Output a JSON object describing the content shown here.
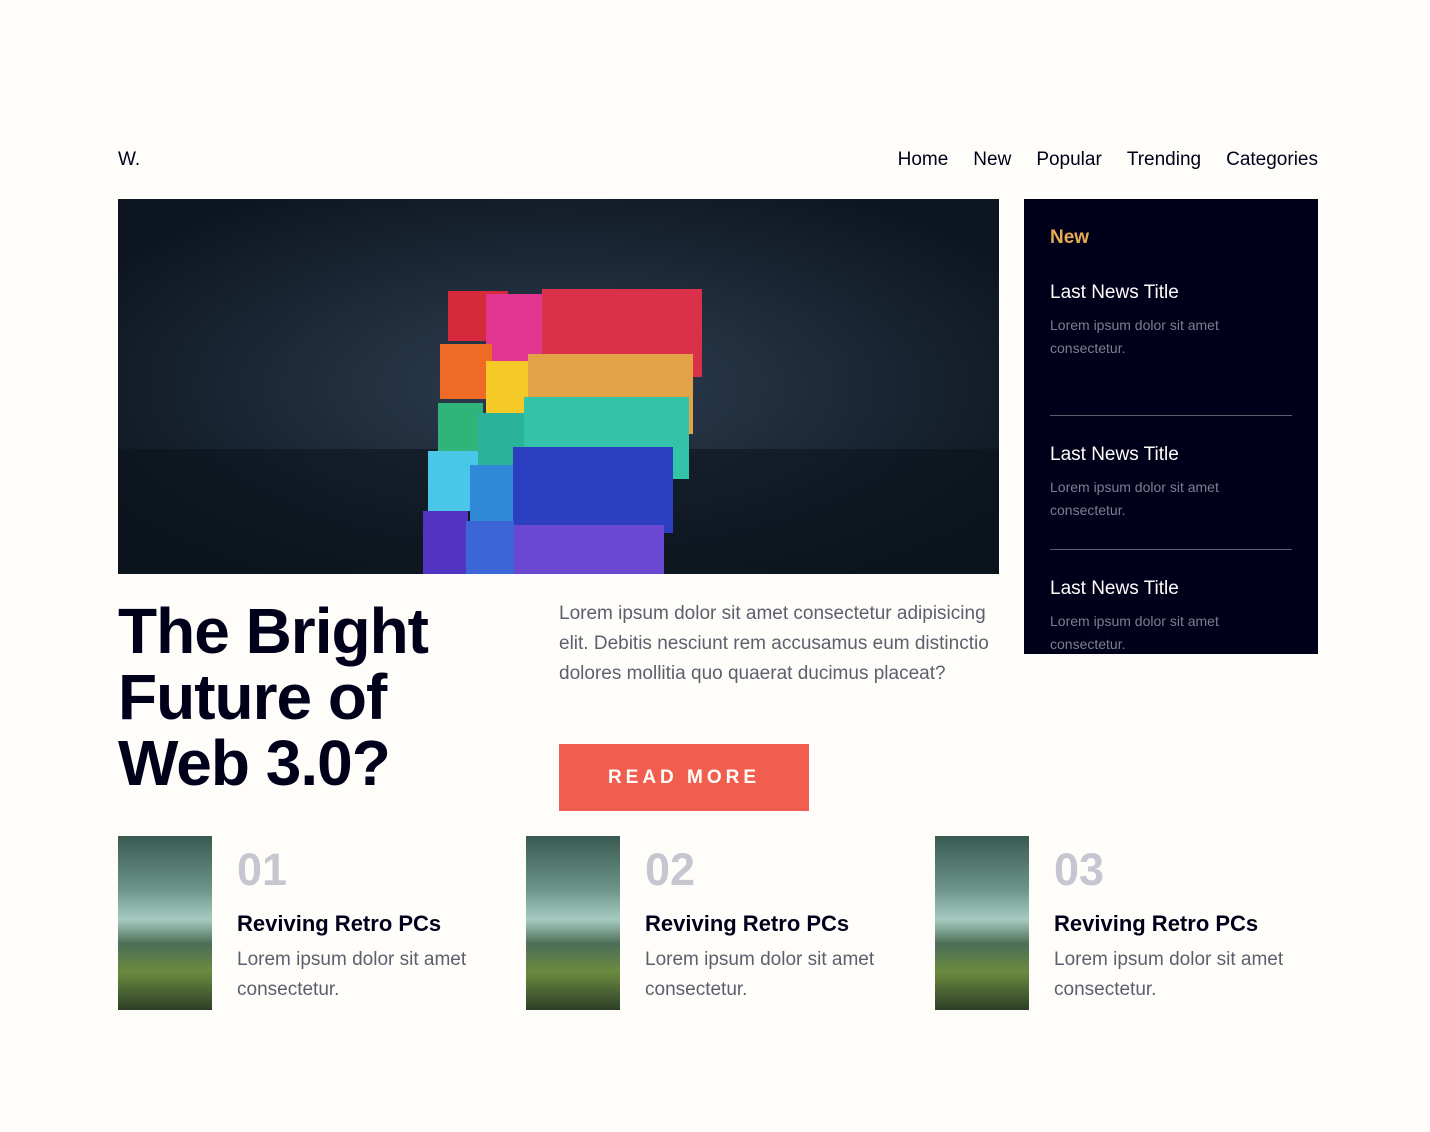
{
  "header": {
    "logo": "W.",
    "nav": [
      "Home",
      "New",
      "Popular",
      "Trending",
      "Categories"
    ]
  },
  "hero": {
    "title_line1": "The Bright",
    "title_line2": "Future of",
    "title_line3": "Web 3.0?",
    "text": "Lorem ipsum dolor sit amet consectetur adipisicing elit. Debitis nesciunt rem accusamus eum distinctio dolores mollitia quo quaerat ducimus placeat?",
    "button": "READ MORE"
  },
  "sidebar": {
    "heading": "New",
    "items": [
      {
        "title": "Last News Title",
        "desc": "Lorem ipsum dolor sit amet consectetur."
      },
      {
        "title": "Last News Title",
        "desc": "Lorem ipsum dolor sit amet consectetur."
      },
      {
        "title": "Last News Title",
        "desc": "Lorem ipsum dolor sit amet consectetur."
      }
    ]
  },
  "cards": [
    {
      "num": "01",
      "title": "Reviving Retro PCs",
      "desc": "Lorem ipsum dolor sit amet consectetur."
    },
    {
      "num": "02",
      "title": "Reviving Retro PCs",
      "desc": "Lorem ipsum dolor sit amet consectetur."
    },
    {
      "num": "03",
      "title": "Reviving Retro PCs",
      "desc": "Lorem ipsum dolor sit amet consectetur."
    }
  ],
  "colors": {
    "background": "#fffdf9",
    "dark": "#00001a",
    "accent": "#f15e50",
    "highlight": "#e9ab53",
    "muted": "#5d5f6d"
  }
}
